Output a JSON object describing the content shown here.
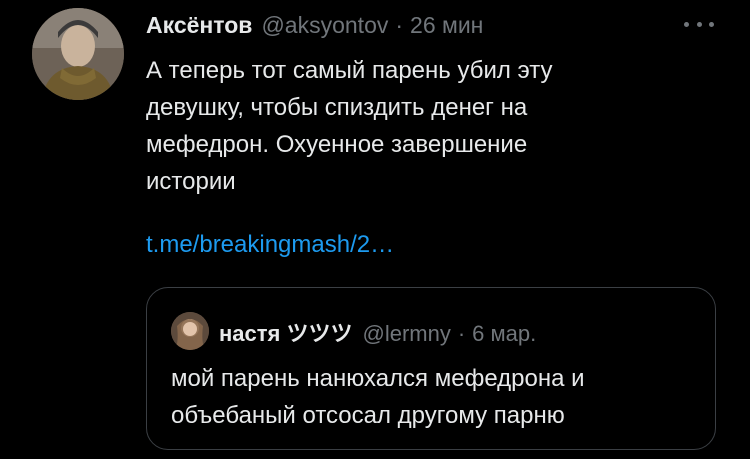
{
  "tweet": {
    "author_name": "Аксёнтов",
    "author_handle": "@aksyontov",
    "separator": "·",
    "time": "26 мин",
    "text_lines": [
      "А теперь тот самый парень убил эту",
      "девушку, чтобы спиздить денег на",
      "мефедрон. Охуенное завершение",
      "истории"
    ],
    "link": "t.me/breakingmash/2…",
    "more_icon": "more-horizontal-icon"
  },
  "quote": {
    "author_name": "настя ツツツ",
    "author_handle": "@lermny",
    "separator": "·",
    "time": "6 мар.",
    "text_lines": [
      "мой парень нанюхался мефедрона и",
      "объебаный отсосал другому парню"
    ]
  },
  "colors": {
    "background": "#000000",
    "text": "#e7e9ea",
    "secondary": "#71767b",
    "link": "#1d9bf0",
    "border": "#3b3f44"
  }
}
